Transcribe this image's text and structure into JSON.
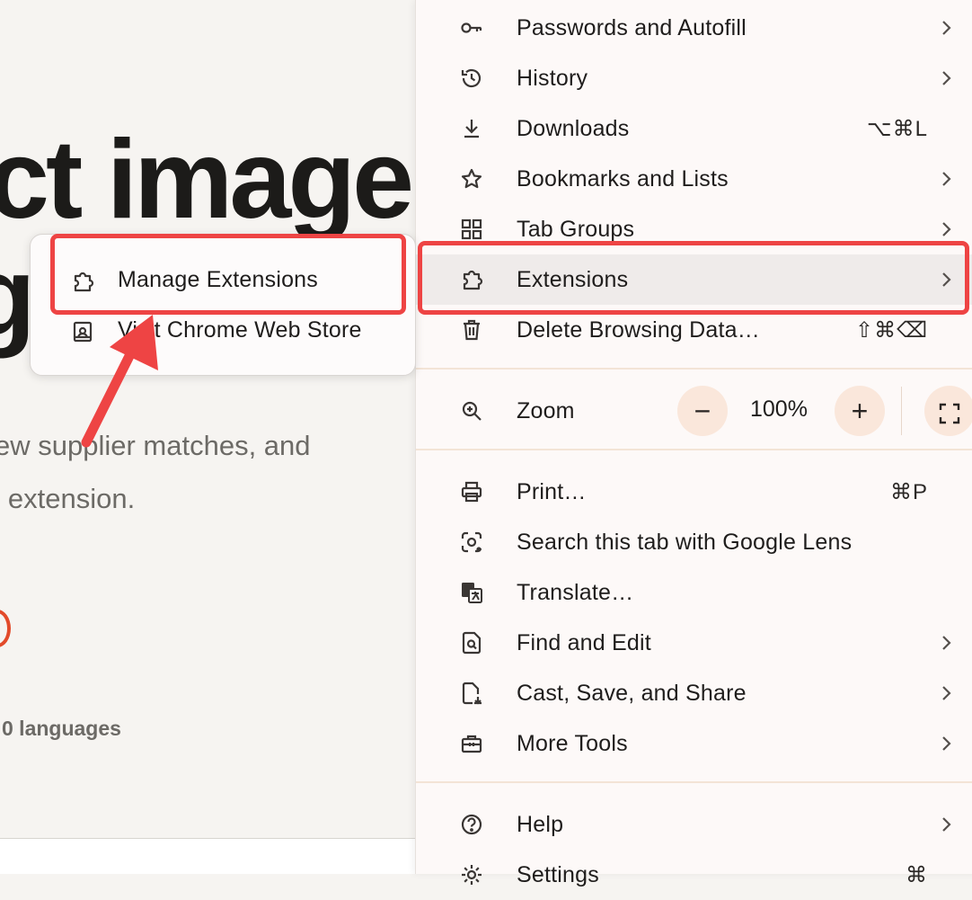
{
  "background": {
    "hero_line1": "ct image",
    "hero_line2": "g",
    "sub_line1": "ew supplier matches, and",
    "sub_line2": "r extension.",
    "languages": "0 languages"
  },
  "menu": {
    "items": [
      {
        "label": "Passwords and Autofill",
        "icon": "key-icon",
        "submenu": true
      },
      {
        "label": "History",
        "icon": "history-icon",
        "submenu": true
      },
      {
        "label": "Downloads",
        "icon": "download-icon",
        "shortcut": "⌥⌘L"
      },
      {
        "label": "Bookmarks and Lists",
        "icon": "star-icon",
        "submenu": true
      },
      {
        "label": "Tab Groups",
        "icon": "tab-groups-icon",
        "submenu": true
      },
      {
        "label": "Extensions",
        "icon": "puzzle-icon",
        "submenu": true,
        "highlighted": true
      },
      {
        "label": "Delete Browsing Data…",
        "icon": "trash-icon",
        "shortcut": "⇧⌘⌫"
      }
    ],
    "zoom": {
      "label": "Zoom",
      "icon": "zoom-icon",
      "minus": "−",
      "value": "100%",
      "plus": "+",
      "fullscreen_icon": "fullscreen-icon"
    },
    "items2": [
      {
        "label": "Print…",
        "icon": "print-icon",
        "shortcut": "⌘P"
      },
      {
        "label": "Search this tab with Google Lens",
        "icon": "lens-icon"
      },
      {
        "label": "Translate…",
        "icon": "translate-icon"
      },
      {
        "label": "Find and Edit",
        "icon": "find-icon",
        "submenu": true
      },
      {
        "label": "Cast, Save, and Share",
        "icon": "cast-save-icon",
        "submenu": true
      },
      {
        "label": "More Tools",
        "icon": "toolbox-icon",
        "submenu": true
      }
    ],
    "items3": [
      {
        "label": "Help",
        "icon": "help-icon",
        "submenu": true
      },
      {
        "label": "Settings",
        "icon": "gear-icon",
        "shortcut": "⌘"
      }
    ]
  },
  "submenu": {
    "items": [
      {
        "label": "Manage Extensions",
        "icon": "puzzle-icon"
      },
      {
        "label": "Visit Chrome Web Store",
        "icon": "web-store-icon"
      }
    ]
  },
  "colors": {
    "annotation": "#ee4444",
    "menu_bg": "#fdf9f8",
    "highlight": "#efebea",
    "zoom_button": "#fae7db"
  }
}
